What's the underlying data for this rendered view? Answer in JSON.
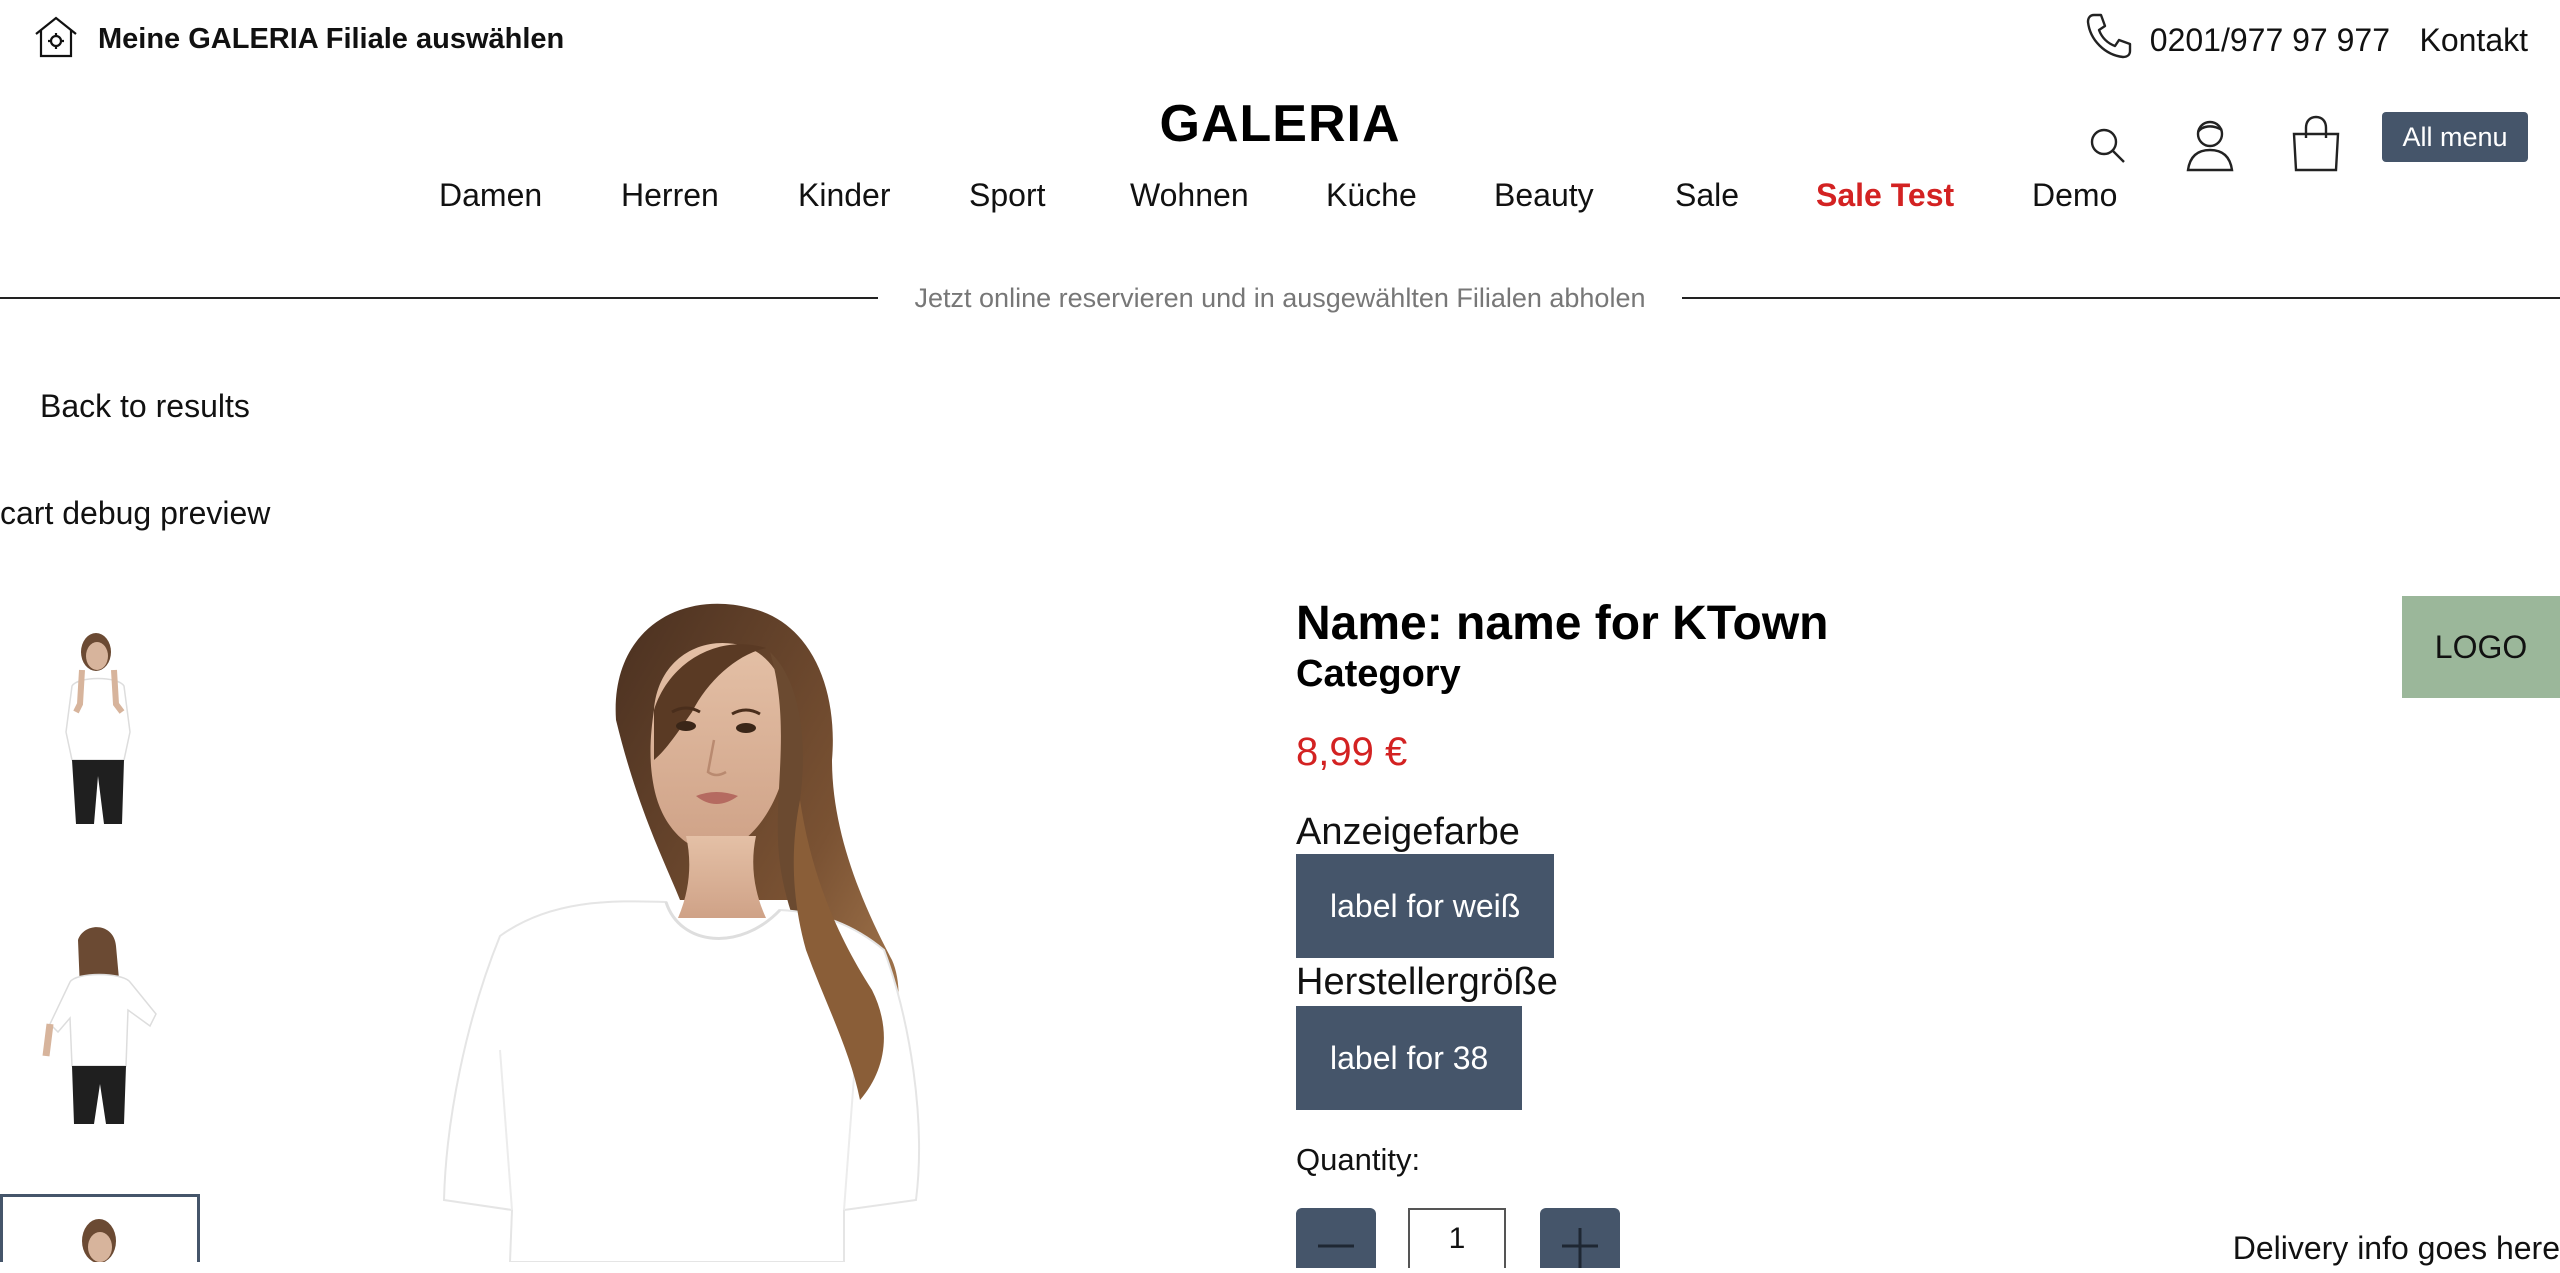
{
  "topbar": {
    "store_select_label": "Meine GALERIA Filiale auswählen",
    "phone": "0201/977 97 977",
    "contact": "Kontakt"
  },
  "header": {
    "brand": "GALERIA",
    "all_menu": "All menu",
    "icons": [
      "search-icon",
      "account-icon",
      "cart-icon"
    ]
  },
  "nav": {
    "items": [
      {
        "label": "Damen"
      },
      {
        "label": "Herren"
      },
      {
        "label": "Kinder"
      },
      {
        "label": "Sport"
      },
      {
        "label": "Wohnen"
      },
      {
        "label": "Küche"
      },
      {
        "label": "Beauty"
      },
      {
        "label": "Sale"
      },
      {
        "label": "Sale Test",
        "highlight": true
      },
      {
        "label": "Demo"
      }
    ]
  },
  "banner": {
    "text": "Jetzt online reservieren und in ausgewählten Filialen abholen"
  },
  "page": {
    "back_link": "Back to results",
    "debug_text": "cart debug preview"
  },
  "gallery": {
    "thumbnails": [
      "front",
      "back",
      "front-crop"
    ],
    "active_thumbnail": 3
  },
  "product": {
    "name": "Name: name for KTown",
    "category": "Category",
    "price": "8,99 €",
    "color_label": "Anzeigefarbe",
    "color_value": "label for weiß",
    "size_label": "Herstellergröße",
    "size_value": "label for 38",
    "quantity_label": "Quantity:",
    "quantity_value": "1",
    "delivery_info": "Delivery info goes here",
    "logo": "LOGO"
  },
  "colors": {
    "accent": "#45556a",
    "sale": "#d32222",
    "logo_bg": "#9bb79a"
  }
}
